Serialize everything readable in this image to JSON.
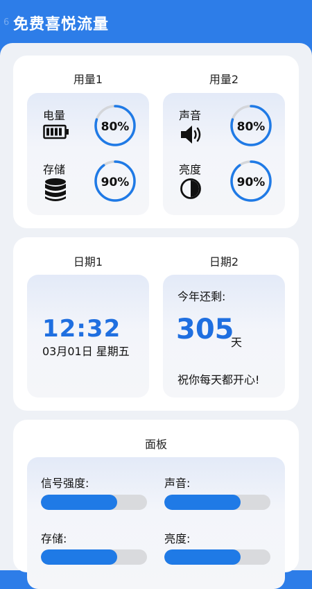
{
  "status": {
    "time_partial": "6"
  },
  "app": {
    "title": "免费喜悦流量"
  },
  "usage": {
    "col1_title": "用量1",
    "col2_title": "用量2",
    "items": [
      {
        "label": "电量",
        "icon": "battery-icon",
        "value": 0.8,
        "display": "80%"
      },
      {
        "label": "存储",
        "icon": "database-icon",
        "value": 0.9,
        "display": "90%"
      },
      {
        "label": "声音",
        "icon": "speaker-icon",
        "value": 0.8,
        "display": "80%"
      },
      {
        "label": "亮度",
        "icon": "brightness-icon",
        "value": 0.9,
        "display": "90%"
      }
    ],
    "ring_color": "#1f7ae6",
    "ring_track_color": "#d4d6da"
  },
  "dates": {
    "col1_title": "日期1",
    "col2_title": "日期2",
    "time": "12:32",
    "date": "03月01日  星期五",
    "remain_label": "今年还剩:",
    "remain_days": "305",
    "remain_unit": "天",
    "wish": "祝你每天都开心!"
  },
  "panel": {
    "title": "面板",
    "bars": [
      {
        "label": "信号强度:",
        "value": 0.72
      },
      {
        "label": "声音:",
        "value": 0.72
      },
      {
        "label": "存储:",
        "value": 0.72
      },
      {
        "label": "亮度:",
        "value": 0.72
      }
    ],
    "accent": "#1f7ae6"
  }
}
